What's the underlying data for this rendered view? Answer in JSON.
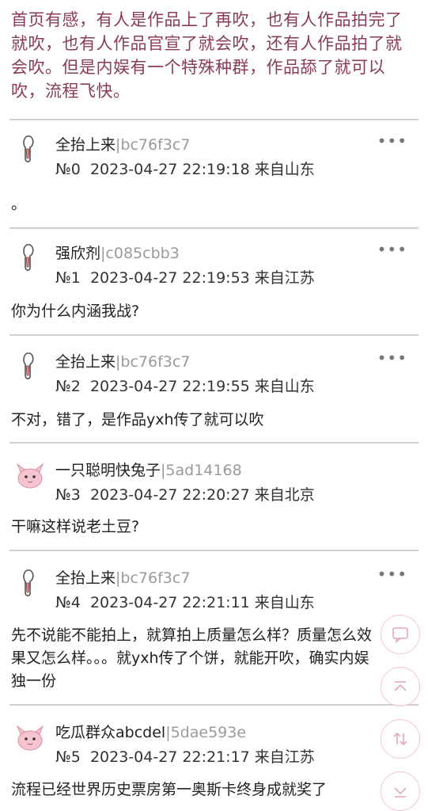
{
  "intro_text": "首页有感，有人是作品上了再吹，也有人作品拍完了就吹，也有人作品官宣了就会吹，还有人作品拍了就会吹。但是内娱有一个特殊种群，作品舔了就可以吹，流程飞快。",
  "posts": [
    {
      "name": "全抬上来",
      "uid": "bc76f3c7",
      "floor": "№0",
      "datetime": "2023-04-27 22:19:18",
      "location": "来自山东",
      "content": "。",
      "avatar": "sketch-avatar"
    },
    {
      "name": "强欣剂",
      "uid": "c085cbb3",
      "floor": "№1",
      "datetime": "2023-04-27 22:19:53",
      "location": "来自江苏",
      "content": "你为什么内涵我战?",
      "avatar": "sketch-avatar"
    },
    {
      "name": "全抬上来",
      "uid": "bc76f3c7",
      "floor": "№2",
      "datetime": "2023-04-27 22:19:55",
      "location": "来自山东",
      "content": "不对，错了，是作品yxh传了就可以吹",
      "avatar": "sketch-avatar"
    },
    {
      "name": "一只聪明快兔子",
      "uid": "5ad14168",
      "floor": "№3",
      "datetime": "2023-04-27 22:20:27",
      "location": "来自北京",
      "content": "干嘛这样说老土豆?",
      "avatar": "pink-creature-avatar"
    },
    {
      "name": "全抬上来",
      "uid": "bc76f3c7",
      "floor": "№4",
      "datetime": "2023-04-27 22:21:11",
      "location": "来自山东",
      "content": "先不说能不能拍上，就算拍上质量怎么样？质量怎么效果又怎么样。。。就yxh传了个饼，就能开吹，确实内娱独一份",
      "avatar": "sketch-avatar"
    },
    {
      "name": "吃瓜群众abcdel",
      "uid": "5dae593e",
      "floor": "№5",
      "datetime": "2023-04-27 22:21:17",
      "location": "来自江苏",
      "content": "流程已经世界历史票房第一奥斯卡终身成就奖了",
      "avatar": "pink-creature-avatar"
    }
  ],
  "more_glyph": "•••",
  "fab_buttons": [
    "comment-icon",
    "scroll-top-icon",
    "refresh-icon",
    "scroll-bottom-icon"
  ],
  "colors": {
    "accent": "#8a3a5a",
    "uid": "#9a9a9a",
    "fab_border": "#f2c6cd"
  }
}
